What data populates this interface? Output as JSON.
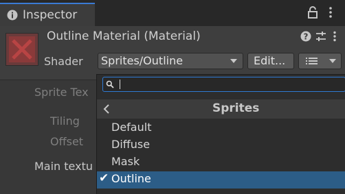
{
  "window": {
    "tab_label": "Inspector",
    "tab_icon": "info-icon",
    "icons": [
      "lock-icon",
      "kebab-menu-icon"
    ]
  },
  "header": {
    "title": "Outline Material (Material)",
    "icons": [
      "help-icon",
      "preset-settings-icon",
      "more-icon"
    ],
    "shader_label": "Shader",
    "shader_value": "Sprites/Outline",
    "edit_label": "Edit...",
    "list_icon": "list-icon"
  },
  "properties": {
    "sprite_texture": "Sprite Tex",
    "tiling": "Tiling",
    "offset": "Offset",
    "main_texture": "Main textu"
  },
  "popup": {
    "search_value": "",
    "section_title": "Sprites",
    "items": [
      {
        "label": "Default",
        "selected": false
      },
      {
        "label": "Diffuse",
        "selected": false
      },
      {
        "label": "Mask",
        "selected": false
      },
      {
        "label": "Outline",
        "selected": true
      }
    ],
    "check_glyph": "✔"
  },
  "colors": {
    "accent": "#2f7bd4",
    "selected_row": "#2c5d87",
    "background": "#383838"
  }
}
